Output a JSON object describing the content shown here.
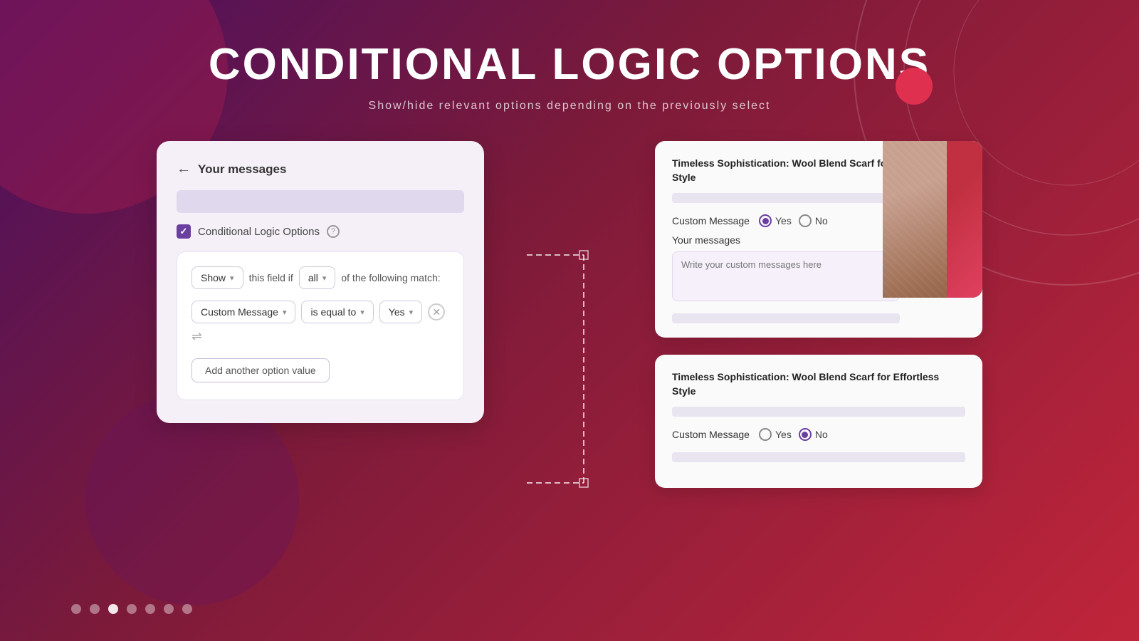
{
  "page": {
    "title": "CONDITIONAL LOGIC OPTIONS",
    "subtitle": "Show/hide relevant options depending on the previously select"
  },
  "left_panel": {
    "back_label": "←",
    "title": "Your messages",
    "checkbox_label": "Conditional Logic Options",
    "logic_row": {
      "show_label": "Show",
      "field_label": "this field if",
      "all_label": "all",
      "following_label": "of the following match:"
    },
    "condition_row": {
      "field_value": "Custom Message",
      "operator_value": "is equal to",
      "match_value": "Yes"
    },
    "add_option_label": "Add another option value"
  },
  "right_top_card": {
    "title": "Timeless Sophistication: Wool Blend Scarf for Effortless Style",
    "custom_message_label": "Custom Message",
    "yes_label": "Yes",
    "no_label": "No",
    "yes_selected": true,
    "no_selected": false,
    "your_messages_label": "Your messages",
    "textarea_placeholder": "Write your custom messages here"
  },
  "right_bottom_card": {
    "title": "Timeless Sophistication: Wool Blend Scarf for Effortless Style",
    "custom_message_label": "Custom Message",
    "yes_label": "Yes",
    "no_label": "No",
    "yes_selected": false,
    "no_selected": true
  },
  "pagination": {
    "dots": [
      {
        "active": false
      },
      {
        "active": false
      },
      {
        "active": true
      },
      {
        "active": false
      },
      {
        "active": false
      },
      {
        "active": false
      },
      {
        "active": false
      }
    ]
  }
}
